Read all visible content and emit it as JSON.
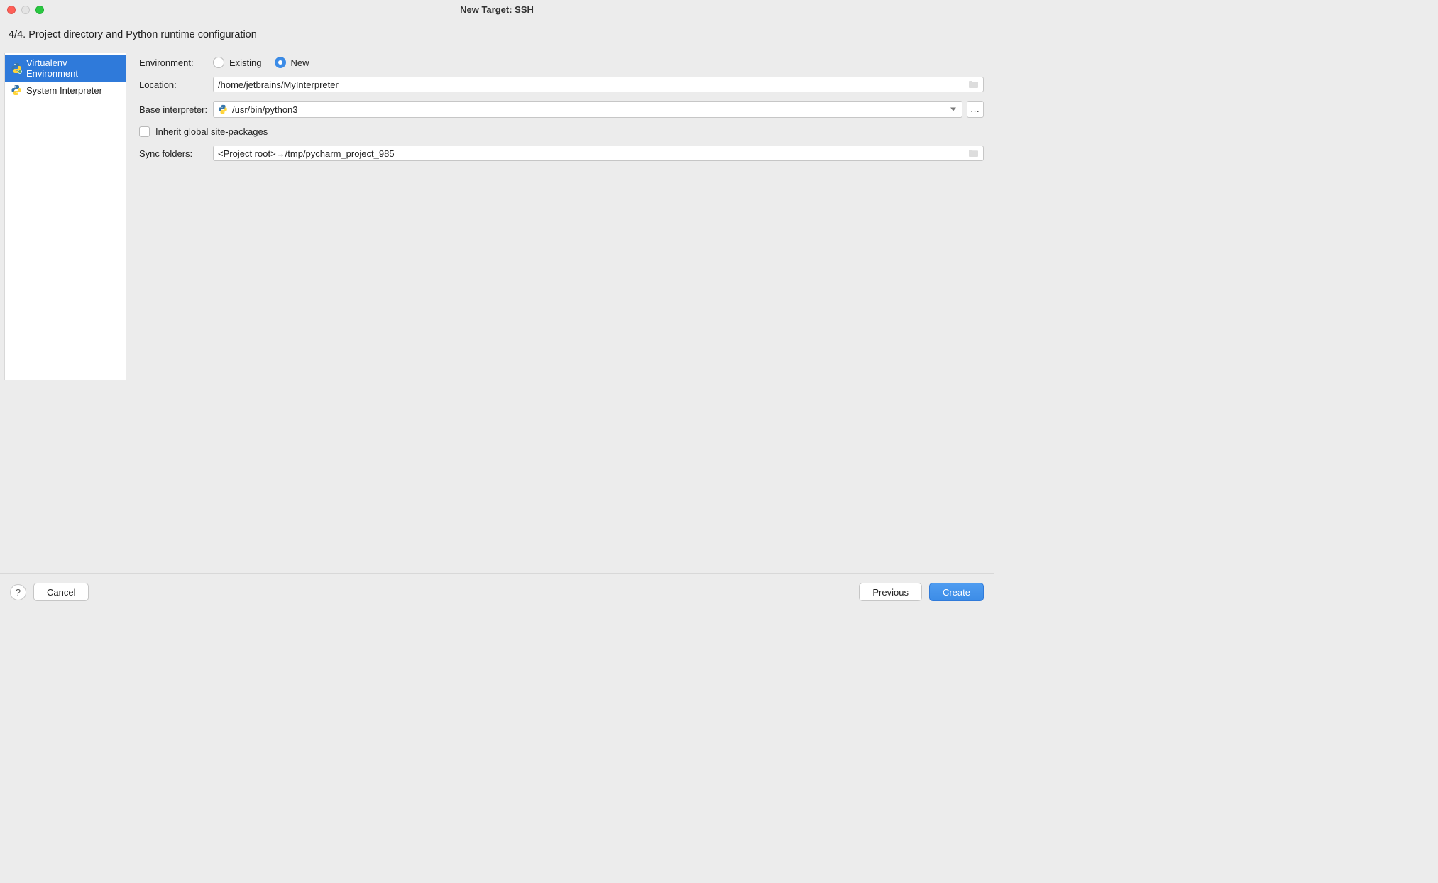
{
  "titlebar": {
    "title": "New Target: SSH"
  },
  "step_header": "4/4. Project directory and Python runtime configuration",
  "sidebar": {
    "items": [
      {
        "label": "Virtualenv Environment",
        "selected": true
      },
      {
        "label": "System Interpreter",
        "selected": false
      }
    ]
  },
  "form": {
    "environment_label": "Environment:",
    "environment_options": {
      "existing": "Existing",
      "new": "New",
      "selected": "new"
    },
    "location_label": "Location:",
    "location_value": "/home/jetbrains/MyInterpreter",
    "base_interpreter_label": "Base interpreter:",
    "base_interpreter_value": "/usr/bin/python3",
    "browse_button": "...",
    "inherit_label": "Inherit global site-packages",
    "inherit_checked": false,
    "sync_label": "Sync folders:",
    "sync_value": "<Project root>→/tmp/pycharm_project_985"
  },
  "footer": {
    "help": "?",
    "cancel": "Cancel",
    "previous": "Previous",
    "create": "Create"
  }
}
